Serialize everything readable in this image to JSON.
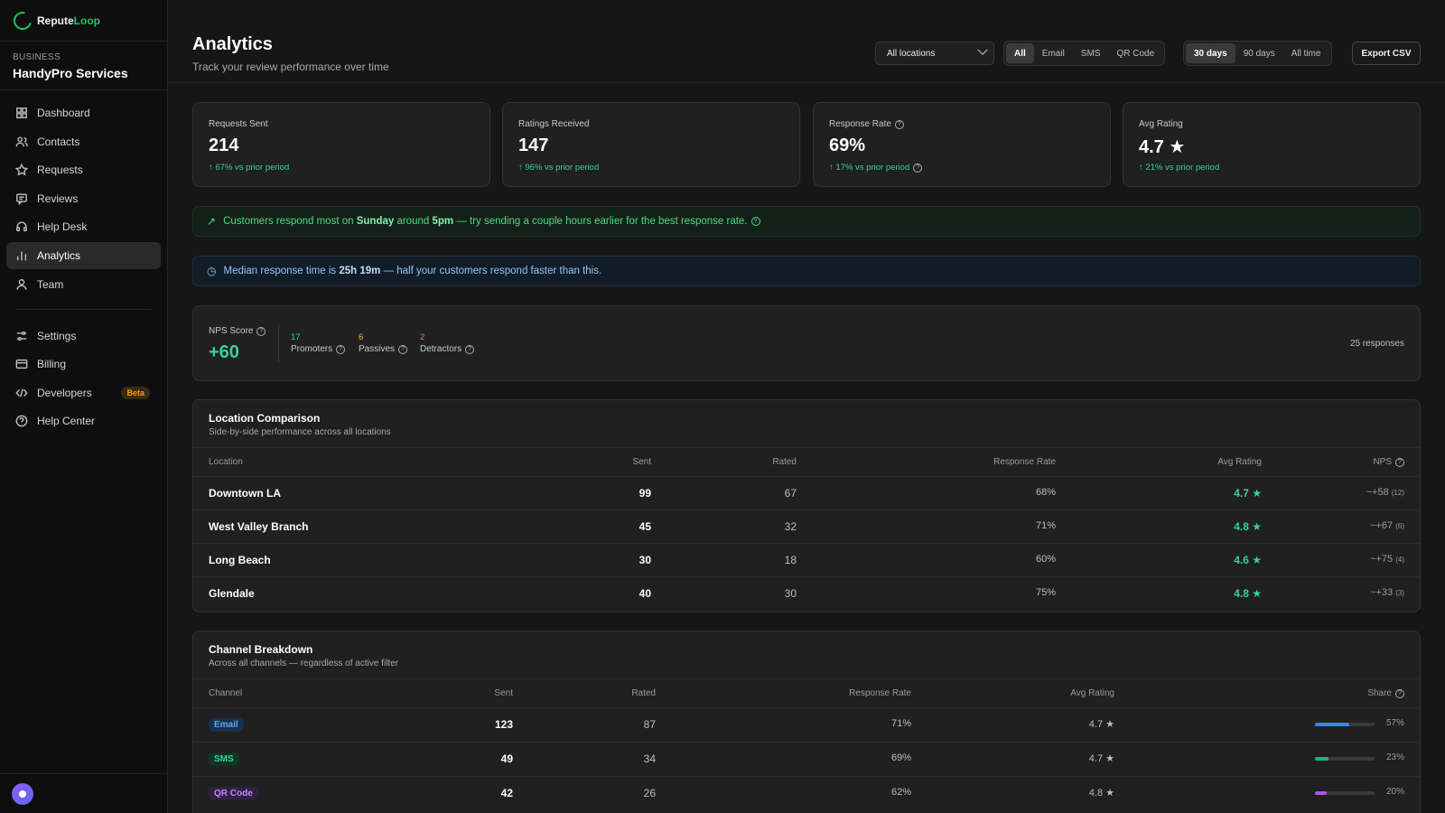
{
  "app": {
    "logo_prefix": "Repute",
    "logo_suffix": "Loop"
  },
  "business": {
    "label": "BUSINESS",
    "name": "HandyPro Services"
  },
  "nav": [
    {
      "label": "Dashboard",
      "icon": "grid-icon"
    },
    {
      "label": "Contacts",
      "icon": "users-icon"
    },
    {
      "label": "Requests",
      "icon": "star-icon"
    },
    {
      "label": "Reviews",
      "icon": "message-icon"
    },
    {
      "label": "Help Desk",
      "icon": "headset-icon"
    },
    {
      "label": "Analytics",
      "icon": "bar-chart-icon",
      "active": true
    },
    {
      "label": "Team",
      "icon": "user-icon"
    }
  ],
  "nav_secondary": [
    {
      "label": "Settings",
      "icon": "sliders-icon"
    },
    {
      "label": "Billing",
      "icon": "card-icon"
    },
    {
      "label": "Developers",
      "icon": "code-icon",
      "badge": "Beta"
    },
    {
      "label": "Help Center",
      "icon": "help-icon"
    }
  ],
  "header": {
    "title": "Analytics",
    "subtitle": "Track your review performance over time",
    "location_select": "All locations",
    "channels": [
      "All",
      "Email",
      "SMS",
      "QR Code"
    ],
    "channel_selected": "All",
    "ranges": [
      "30 days",
      "90 days",
      "All time"
    ],
    "range_selected": "30 days",
    "export_label": "Export CSV"
  },
  "stats": [
    {
      "label": "Requests Sent",
      "value": "214",
      "delta": "↑ 67% vs prior period"
    },
    {
      "label": "Ratings Received",
      "value": "147",
      "delta": "↑ 96% vs prior period"
    },
    {
      "label": "Response Rate",
      "value": "69%",
      "delta": "↑ 17% vs prior period"
    },
    {
      "label": "Avg Rating",
      "value": "4.7 ★",
      "delta": "↑ 21% vs prior period"
    }
  ],
  "insight_green": {
    "pre": "Customers respond most on ",
    "day": "Sunday",
    "mid": " around ",
    "time": "5pm",
    "post": " — try sending a couple hours earlier for the best response rate."
  },
  "insight_blue": {
    "pre": "Median response time is ",
    "value": "25h 19m",
    "post": " — half your customers respond faster than this."
  },
  "nps": {
    "label": "NPS Score",
    "value": "+60",
    "promoters": {
      "count": "17",
      "label": "Promoters"
    },
    "passives": {
      "count": "6",
      "label": "Passives"
    },
    "detractors": {
      "count": "2",
      "label": "Detractors"
    },
    "responses": "25 responses"
  },
  "location_table": {
    "title": "Location Comparison",
    "subtitle": "Side-by-side performance across all locations",
    "headers": [
      "Location",
      "Sent",
      "Rated",
      "Response Rate",
      "Avg Rating",
      "NPS"
    ],
    "rows": [
      {
        "location": "Downtown LA",
        "sent": "99",
        "rated": "67",
        "rate": "68%",
        "avg": "4.7 ★",
        "nps": "~+58",
        "nps_n": "(12)"
      },
      {
        "location": "West Valley Branch",
        "sent": "45",
        "rated": "32",
        "rate": "71%",
        "avg": "4.8 ★",
        "nps": "~+67",
        "nps_n": "(6)"
      },
      {
        "location": "Long Beach",
        "sent": "30",
        "rated": "18",
        "rate": "60%",
        "avg": "4.6 ★",
        "nps": "~+75",
        "nps_n": "(4)"
      },
      {
        "location": "Glendale",
        "sent": "40",
        "rated": "30",
        "rate": "75%",
        "avg": "4.8 ★",
        "nps": "~+33",
        "nps_n": "(3)"
      }
    ]
  },
  "channel_table": {
    "title": "Channel Breakdown",
    "subtitle": "Across all channels — regardless of active filter",
    "headers": [
      "Channel",
      "Sent",
      "Rated",
      "Response Rate",
      "Avg Rating",
      "Share"
    ],
    "rows": [
      {
        "channel": "Email",
        "sent": "123",
        "rated": "87",
        "rate": "71%",
        "avg": "4.7 ★",
        "share": "57%",
        "share_value": 57,
        "pill_bg": "#17324d",
        "pill_fg": "#60a5fa",
        "bar_color": "#3b82f6"
      },
      {
        "channel": "SMS",
        "sent": "49",
        "rated": "34",
        "rate": "69%",
        "avg": "4.7 ★",
        "share": "23%",
        "share_value": 23,
        "pill_bg": "#123326",
        "pill_fg": "#34d399",
        "bar_color": "#10b981"
      },
      {
        "channel": "QR Code",
        "sent": "42",
        "rated": "26",
        "rate": "62%",
        "avg": "4.8 ★",
        "share": "20%",
        "share_value": 20,
        "pill_bg": "#2d2240",
        "pill_fg": "#c084fc",
        "bar_color": "#a855f7"
      }
    ]
  }
}
